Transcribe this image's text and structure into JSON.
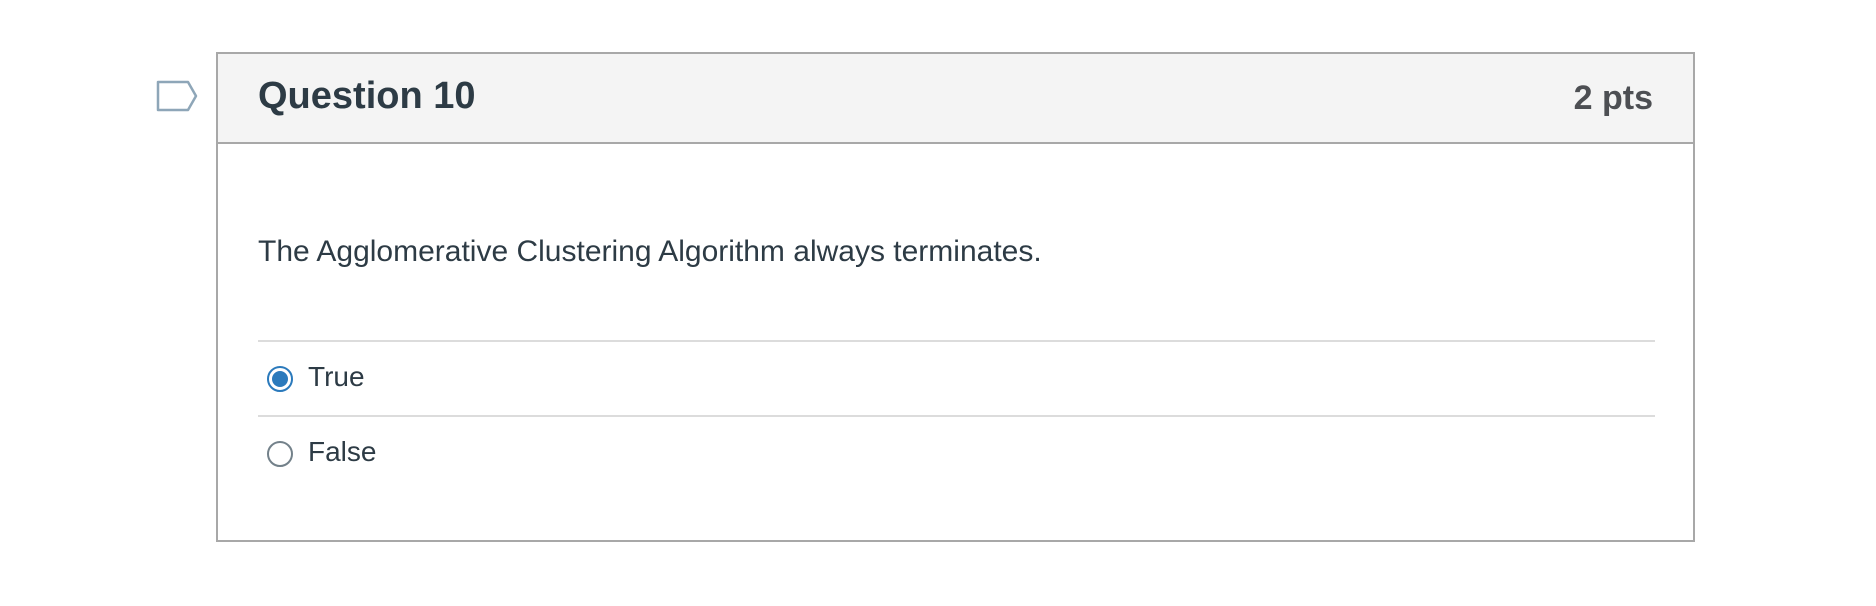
{
  "question": {
    "title": "Question 10",
    "points": "2 pts",
    "text": "The Agglomerative Clustering Algorithm always terminates.",
    "flag_icon": "flag-icon",
    "answers": [
      {
        "label": "True",
        "selected": true
      },
      {
        "label": "False",
        "selected": false
      }
    ]
  },
  "colors": {
    "border": "#a8a8a8",
    "header_bg": "#f4f4f4",
    "radio_selected": "#2b7abc",
    "text": "#2d3b45"
  }
}
